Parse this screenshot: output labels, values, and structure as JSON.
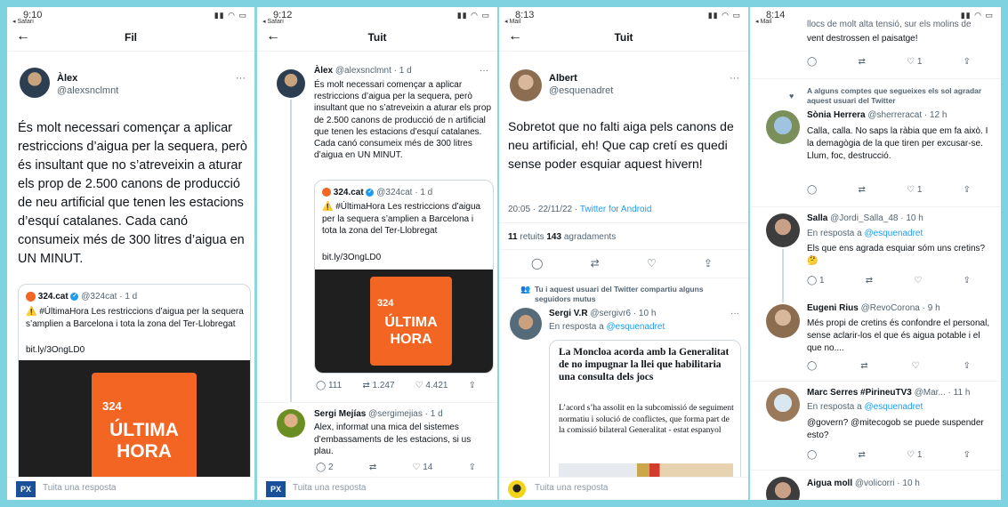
{
  "panel1": {
    "status_time": "9:10",
    "status_back": "◂ Safari",
    "title": "Fil",
    "author_name": "Àlex",
    "author_handle": "@alexsnclmnt",
    "tweet_text": "És molt necessari començar a aplicar restriccions d’aigua per la sequera, però és insultant que no s’atreveixin a aturar els prop de 2.500 canons de producció de neu artificial que tenen les estacions d’esquí catalanes. Cada canó consumeix més de 300 litres d’aigua en UN MINUT.",
    "quote_name": "324.cat",
    "quote_handle": "@324cat · 1 d",
    "quote_text": "⚠️ #ÚltimaHora Les restriccions d’aigua per la sequera s’amplien a Barcelona i tota la zona del Ter-Llobregat",
    "quote_link": "bit.ly/3OngLD0",
    "image_logo": "324",
    "image_line1": "ÚLTIMA",
    "image_line2": "HORA",
    "reply_logo": "PX",
    "reply_placeholder": "Tuita una resposta"
  },
  "panel2": {
    "status_time": "9:12",
    "status_back": "◂ Safari",
    "title": "Tuit",
    "author_name": "Àlex",
    "author_handle": "@alexsnclmnt · 1 d",
    "tweet_text": "És molt necessari començar a aplicar restriccions d’aigua per la sequera, però insultant que no s’atreveixin a aturar els prop de 2.500 canons de producció de n artificial que tenen les estacions d’esquí catalanes. Cada canó consumeix més de 300 litres d’aigua en UN MINUT.",
    "quote_name": "324.cat",
    "quote_handle": "@324cat · 1 d",
    "quote_text": "⚠️ #ÚltimaHora Les restriccions d’aigua per la sequera s’amplien a Barcelona i tota la zona del Ter-Llobregat",
    "quote_link": "bit.ly/3OngLD0",
    "image_logo": "324",
    "image_line1": "ÚLTIMA",
    "image_line2": "HORA",
    "stat_replies": "111",
    "stat_retweets": "1.247",
    "stat_likes": "4.421",
    "reply_name": "Sergi Mejías",
    "reply_handle": "@sergimejias · 1 d",
    "reply_text": "Alex, informat una mica del sistemes d’embassaments de les estacions, si us plau.",
    "reply_replies": "2",
    "reply_likes": "14",
    "reply_logo": "PX",
    "reply_placeholder": "Tuita una resposta"
  },
  "panel3": {
    "status_time": "8:13",
    "status_back": "◂ Mail",
    "title": "Tuit",
    "author_name": "Albert",
    "author_handle": "@esquenadret",
    "tweet_text": "Sobretot que no falti aiga pels canons de neu artificial, eh! Que cap cretí es quedi sense poder esquiar aquest hivern!",
    "timestamp": "20:05 · 22/11/22 · ",
    "client": "Twitter for Android",
    "retweets_count": "11",
    "retweets_label": "retuits",
    "likes_count": "143",
    "likes_label": "agradaments",
    "social_context": "Tu i aquest usuari del Twitter compartiu alguns seguidors mutus",
    "reply_name": "Sergi V.R",
    "reply_handle": "@sergivr6 · 10 h",
    "reply_to_prefix": "En resposta a ",
    "reply_to_user": "@esquenadret",
    "article_title": "La Moncloa acorda amb la Generalitat de no impugnar la llei que habilitaria una consulta dels jocs",
    "article_body": "L’acord s’ha assolit en la subcomissió de seguiment normatiu i solució de conflictes, que forma part de la comissió bilateral Generalitat - estat espanyol",
    "reply_placeholder": "Tuita una resposta"
  },
  "panel4": {
    "status_time": "8:14",
    "status_back": "◂ Mail",
    "top_text_1": "llocs de molt alta tensió, sur els molins de",
    "top_text_2": "vent destrossen el paisatge!",
    "top_likes": "1",
    "liked_context": "A alguns comptes que segueixes els sol agradar aquest usuari del Twitter",
    "replies": [
      {
        "name": "Sònia Herrera",
        "handle": "@sherreracat · 12 h",
        "reply_to": "",
        "text": "Calla, calla. No saps la ràbia que em fa això. I la demagògia de la que tiren per excusar-se. Llum, foc, destrucció.",
        "likes": "1"
      },
      {
        "name": "Salla",
        "handle": "@Jordi_Salla_48 · 10 h",
        "reply_to": "@esquenadret",
        "text": "Els que ens agrada esquiar sóm uns cretins? 🤔",
        "replies": "1",
        "likes": ""
      },
      {
        "name": "Eugeni Rius",
        "handle": "@RevoCorona · 9 h",
        "reply_to": "",
        "text": "Més propi de cretins és confondre el personal, sense aclarir-los el que és aigua potable i el que no....",
        "likes": ""
      },
      {
        "name": "Marc Serres #PirineuTV3",
        "handle": "@Mar... · 11 h",
        "reply_to": "@esquenadret",
        "text": "@govern? @mitecogob se puede suspender esto?",
        "likes": "1"
      },
      {
        "name": "Aigua moll",
        "handle": "@volicorri · 10 h",
        "reply_to": "",
        "text": "",
        "likes": ""
      }
    ],
    "reply_prefix": "En resposta a "
  },
  "icons": {
    "reply": "◯",
    "retweet": "⇄",
    "like": "♡",
    "share": "⇪"
  },
  "colors": {
    "accent": "#1d9bf0",
    "frame": "#8ad6e2",
    "orange": "#f26522"
  }
}
